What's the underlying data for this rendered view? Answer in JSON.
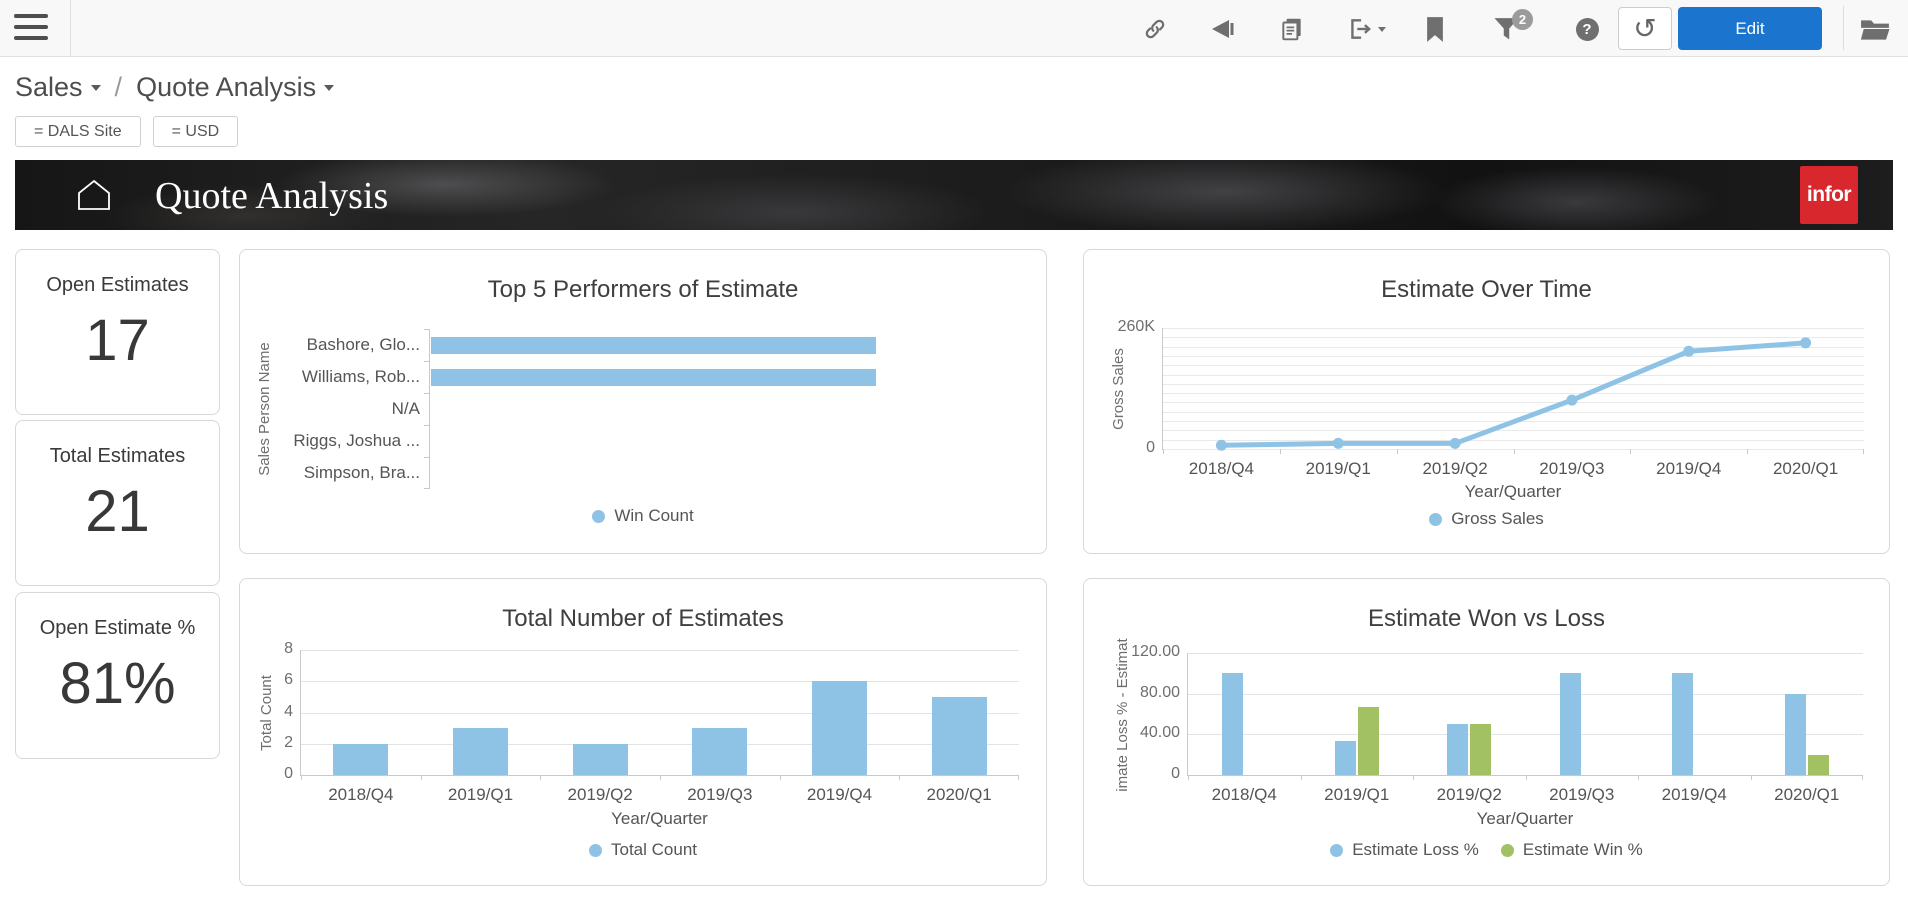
{
  "toolbar": {
    "edit_label": "Edit",
    "filter_badge": "2",
    "icons": [
      "hamburger-icon",
      "link-icon",
      "megaphone-icon",
      "copy-icon",
      "export-icon",
      "bookmark-icon",
      "filter-icon",
      "help-icon",
      "refresh-icon",
      "folder-icon"
    ]
  },
  "icons": {
    "help_glyph": "?",
    "refresh_glyph": "↺"
  },
  "breadcrumb": {
    "section": "Sales",
    "page": "Quote Analysis",
    "separator": "/"
  },
  "filters": [
    {
      "label": "= DALS Site"
    },
    {
      "label": "= USD"
    }
  ],
  "banner": {
    "title": "Quote Analysis",
    "logo_text": "infor"
  },
  "kpis": [
    {
      "label": "Open Estimates",
      "value": "17"
    },
    {
      "label": "Total Estimates",
      "value": "21"
    },
    {
      "label": "Open Estimate %",
      "value": "81%"
    }
  ],
  "colors": {
    "accent_blue": "#1b75ce",
    "series_blue": "#8FC3E6",
    "series_green": "#A2C162",
    "infor_red": "#d9272e"
  },
  "chart_data": [
    {
      "type": "bar",
      "orientation": "horizontal",
      "title": "Top 5 Performers of Estimate",
      "xlabel": "",
      "ylabel": "Sales Person Name",
      "categories": [
        "Bashore, Glo...",
        "Williams, Rob...",
        "N/A",
        "Riggs, Joshua ...",
        "Simpson, Bra..."
      ],
      "series": [
        {
          "name": "Win Count",
          "color": "#8FC3E6",
          "values": [
            1,
            1,
            0,
            0,
            0
          ]
        }
      ],
      "xlim": [
        0,
        1.33
      ],
      "grid": false,
      "legend_position": "bottom"
    },
    {
      "type": "line",
      "title": "Estimate Over Time",
      "xlabel": "Year/Quarter",
      "ylabel": "Gross Sales",
      "categories": [
        "2018/Q4",
        "2019/Q1",
        "2019/Q2",
        "2019/Q3",
        "2019/Q4",
        "2020/Q1"
      ],
      "series": [
        {
          "name": "Gross Sales",
          "color": "#8FC3E6",
          "values": [
            8000,
            12000,
            12000,
            105000,
            210000,
            228000
          ]
        }
      ],
      "ylim": [
        0,
        260000
      ],
      "yticks": [
        {
          "value": 260000,
          "label": "260K"
        },
        {
          "value": 0,
          "label": "0"
        }
      ],
      "minor_grid_count": 13,
      "grid": true,
      "legend_position": "bottom"
    },
    {
      "type": "bar",
      "title": "Total Number of Estimates",
      "xlabel": "Year/Quarter",
      "ylabel": "Total Count",
      "categories": [
        "2018/Q4",
        "2019/Q1",
        "2019/Q2",
        "2019/Q3",
        "2019/Q4",
        "2020/Q1"
      ],
      "series": [
        {
          "name": "Total Count",
          "color": "#8FC3E6",
          "values": [
            2,
            3,
            2,
            3,
            6,
            5
          ]
        }
      ],
      "ylim": [
        0,
        8
      ],
      "yticks": [
        {
          "value": 8,
          "label": "8"
        },
        {
          "value": 6,
          "label": "6"
        },
        {
          "value": 4,
          "label": "4"
        },
        {
          "value": 2,
          "label": "2"
        },
        {
          "value": 0,
          "label": "0"
        }
      ],
      "grid": true,
      "legend_position": "bottom"
    },
    {
      "type": "bar",
      "title": "Estimate Won vs Loss",
      "xlabel": "Year/Quarter",
      "ylabel": "imate Loss % - Estimat",
      "categories": [
        "2018/Q4",
        "2019/Q1",
        "2019/Q2",
        "2019/Q3",
        "2019/Q4",
        "2020/Q1"
      ],
      "series": [
        {
          "name": "Estimate Loss %",
          "color": "#8FC3E6",
          "values": [
            100,
            33.33,
            50,
            100,
            100,
            80
          ]
        },
        {
          "name": "Estimate Win %",
          "color": "#A2C162",
          "values": [
            0,
            66.67,
            50,
            0,
            0,
            20
          ]
        }
      ],
      "ylim": [
        0,
        120
      ],
      "yticks": [
        {
          "value": 120,
          "label": "120.00"
        },
        {
          "value": 80,
          "label": "80.00"
        },
        {
          "value": 40,
          "label": "40.00"
        },
        {
          "value": 0,
          "label": "0"
        }
      ],
      "grid": true,
      "legend_position": "bottom"
    }
  ]
}
